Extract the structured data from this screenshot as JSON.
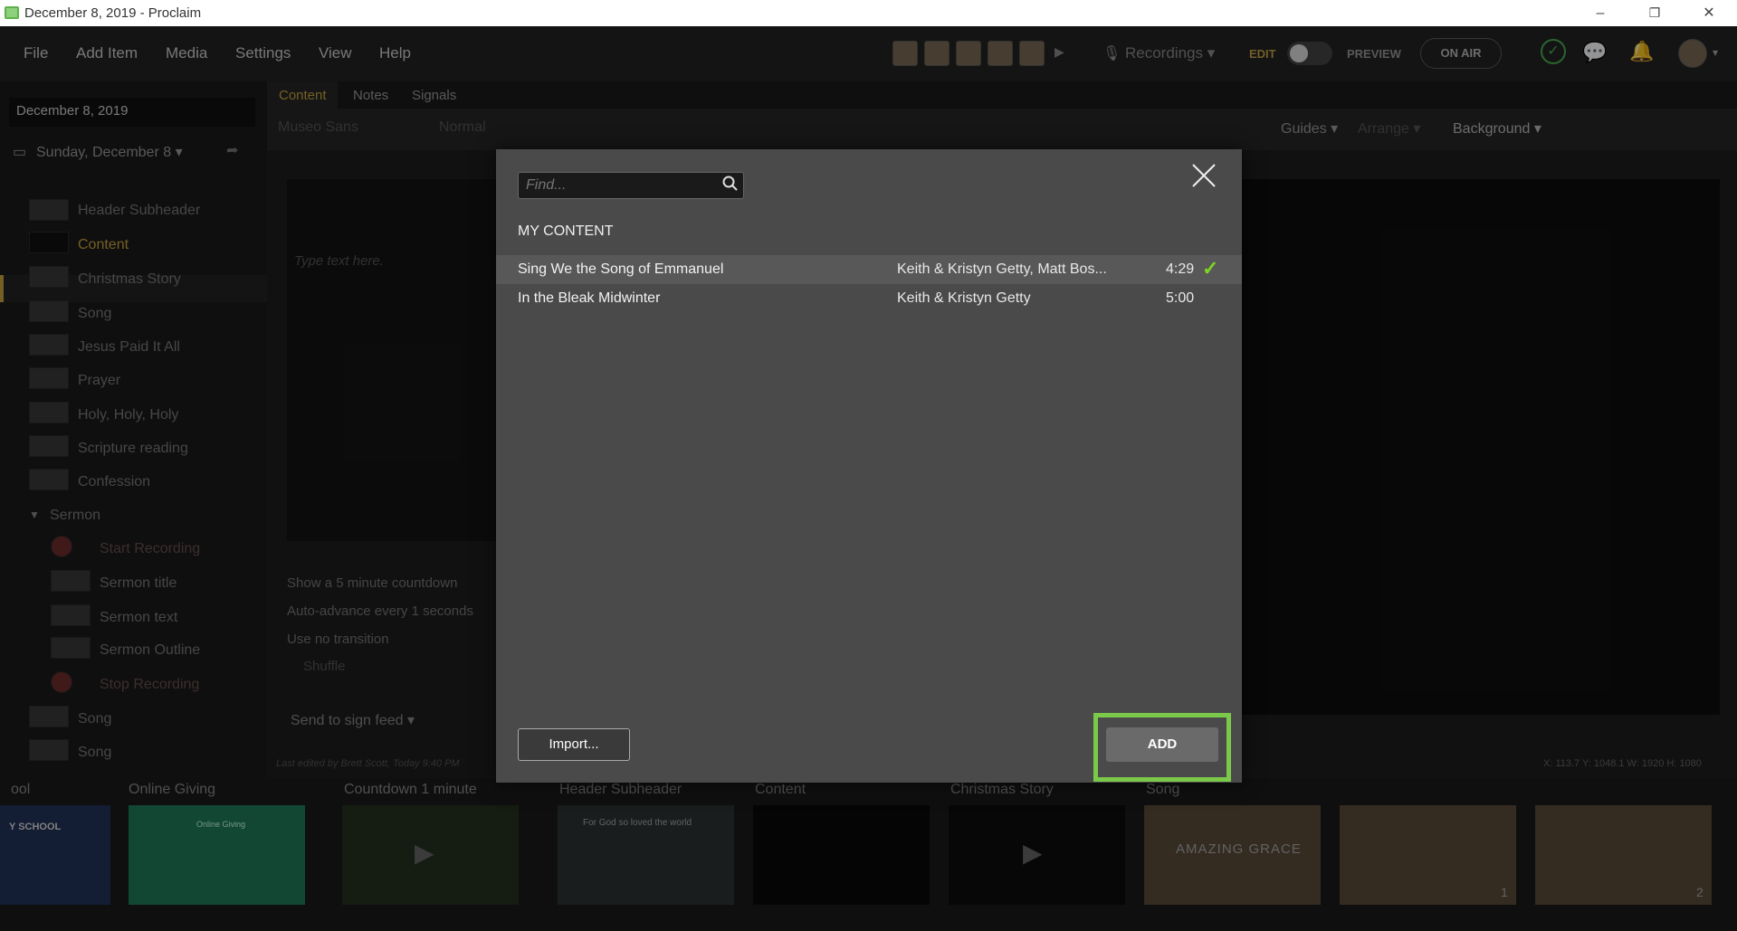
{
  "window": {
    "title": "December 8, 2019 - Proclaim",
    "minimize": "–",
    "restore": "❐",
    "close": "✕"
  },
  "menu": {
    "items": [
      "File",
      "Add Item",
      "Media",
      "Settings",
      "View",
      "Help"
    ],
    "recordings": "Recordings ▾",
    "edit": "EDIT",
    "preview": "PREVIEW",
    "on_air": "ON AIR"
  },
  "left_panel": {
    "date": "December 8, 2019",
    "service_date": "Sunday, December 8 ▾",
    "items": [
      {
        "label": "Header Subheader",
        "level": 0
      },
      {
        "label": "Content",
        "level": 0,
        "active": true
      },
      {
        "label": "Christmas Story",
        "level": 0
      },
      {
        "label": "Song",
        "level": 0
      },
      {
        "label": "Jesus Paid It All",
        "level": 0
      },
      {
        "label": "Prayer",
        "level": 0
      },
      {
        "label": "Holy, Holy, Holy",
        "level": 0
      },
      {
        "label": "Scripture reading",
        "level": 0
      },
      {
        "label": "Confession",
        "level": 0
      },
      {
        "label": "Sermon",
        "level": 0
      },
      {
        "label": "Start Recording",
        "level": 1
      },
      {
        "label": "Sermon title",
        "level": 1
      },
      {
        "label": "Sermon text",
        "level": 1
      },
      {
        "label": "Sermon Outline",
        "level": 1
      },
      {
        "label": "Stop Recording",
        "level": 1
      },
      {
        "label": "Song",
        "level": 0
      },
      {
        "label": "Song",
        "level": 0
      }
    ]
  },
  "editor": {
    "tabs": [
      "Content",
      "Notes",
      "Signals"
    ],
    "font": "Museo Sans",
    "weight": "Normal",
    "toolbar_right": [
      "Guides ▾",
      "Arrange ▾",
      "Background ▾"
    ],
    "placeholder": "Type text here.",
    "options": [
      "Show a 5 minute countdown",
      "Auto-advance every 1 seconds",
      "Use no transition",
      "Shuffle"
    ],
    "send": "Send to sign feed ▾",
    "last_edited": "Last edited by Brett Scott, Today 9:40 PM",
    "coords": "X: 113.7  Y: 1048.1   W: 1920  H: 1080"
  },
  "bottom_strip": {
    "cards": [
      {
        "label": "ool",
        "thumb_text": "Y SCHOOL"
      },
      {
        "label": "Online Giving",
        "thumb_text": "Online Giving"
      },
      {
        "label": "Countdown 1 minute",
        "thumb_text": ""
      },
      {
        "label": "Header Subheader",
        "thumb_text": "For God so loved the world"
      },
      {
        "label": "Content",
        "thumb_text": ""
      },
      {
        "label": "Christmas Story",
        "thumb_text": ""
      },
      {
        "label": "Song",
        "thumb_text": "AMAZING GRACE"
      },
      {
        "label": "",
        "thumb_text": "1"
      },
      {
        "label": "",
        "thumb_text": "2"
      }
    ]
  },
  "modal": {
    "find_placeholder": "Find...",
    "heading": "MY CONTENT",
    "rows": [
      {
        "title": "Sing We the Song of Emmanuel",
        "artist": "Keith & Kristyn Getty, Matt Bos...",
        "duration": "4:29",
        "selected": true
      },
      {
        "title": "In the Bleak Midwinter",
        "artist": "Keith & Kristyn Getty",
        "duration": "5:00",
        "selected": false
      }
    ],
    "import_label": "Import...",
    "add_label": "ADD",
    "colors": {
      "highlight": "#7bc94a",
      "check": "#7ed321"
    }
  }
}
